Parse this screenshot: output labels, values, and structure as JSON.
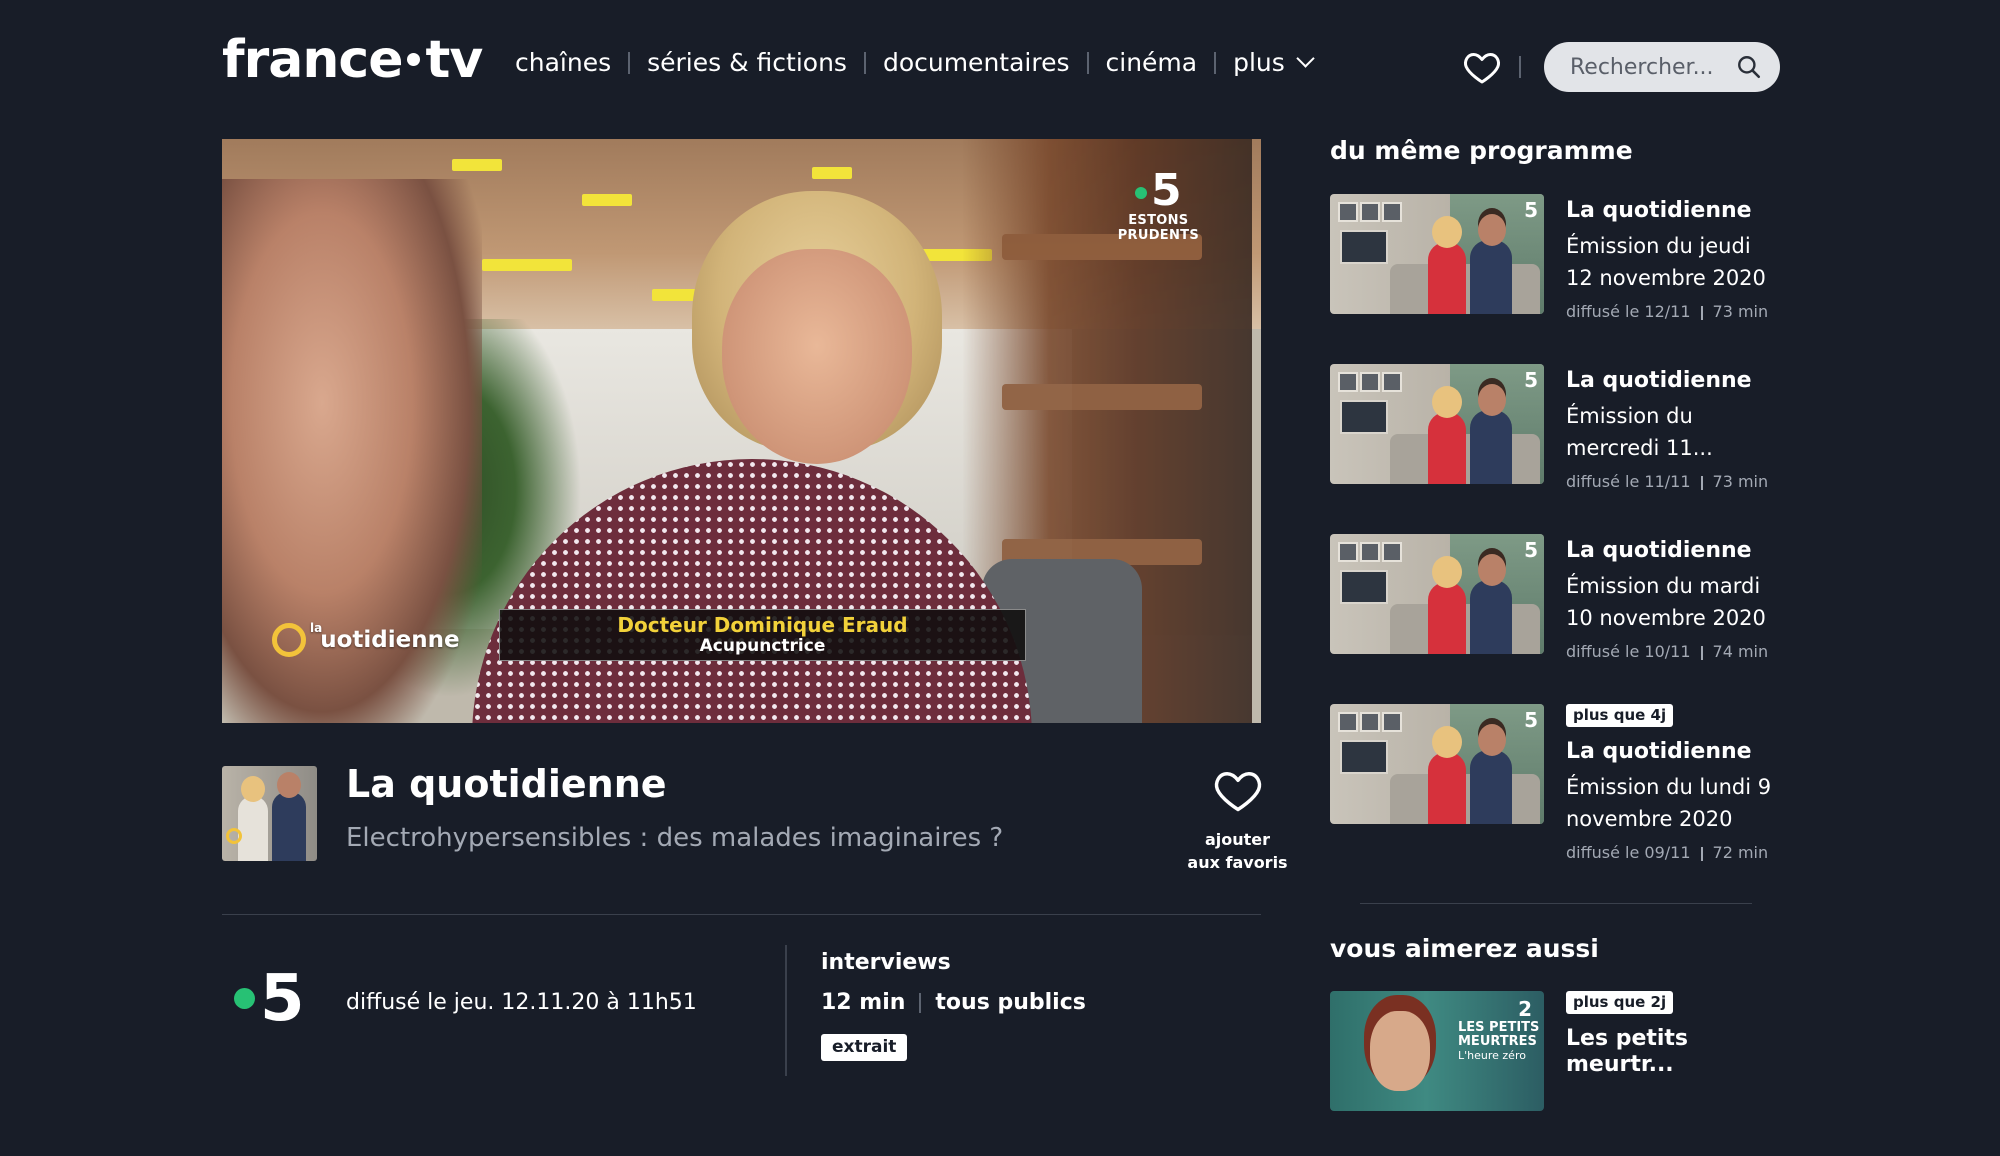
{
  "header": {
    "logo_left": "france",
    "logo_right": "tv",
    "nav": [
      "chaînes",
      "séries & fictions",
      "documentaires",
      "cinéma",
      "plus"
    ],
    "search_placeholder": "Rechercher..."
  },
  "player": {
    "channel_number": "5",
    "channel_tagline_1": "ESTONS",
    "channel_tagline_2": "PRUDENTS",
    "show_logo_small": "la",
    "show_logo_text": "uotidienne",
    "guest_name": "Docteur Dominique Eraud",
    "guest_role": "Acupunctrice"
  },
  "program": {
    "title": "La quotidienne",
    "subtitle": "Electrohypersensibles : des malades imaginaires ?",
    "favorite_line1": "ajouter",
    "favorite_line2": "aux favoris",
    "channel": "5",
    "aired": "diffusé le jeu. 12.11.20 à 11h51",
    "genre": "interviews",
    "duration": "12 min",
    "audience": "tous publics",
    "badge": "extrait"
  },
  "sidebar": {
    "same_program_title": "du même programme",
    "episodes": [
      {
        "title": "La quotidienne",
        "subtitle": "Émission du jeudi 12 novembre 2020",
        "aired": "diffusé le 12/11",
        "duration": "73 min"
      },
      {
        "title": "La quotidienne",
        "subtitle": "Émission du mercredi 11...",
        "aired": "diffusé le 11/11",
        "duration": "73 min"
      },
      {
        "title": "La quotidienne",
        "subtitle": "Émission du mardi 10 novembre 2020",
        "aired": "diffusé le 10/11",
        "duration": "74 min"
      },
      {
        "badge": "plus que 4j",
        "title": "La quotidienne",
        "subtitle": "Émission du lundi 9 novembre 2020",
        "aired": "diffusé le 09/11",
        "duration": "72 min"
      }
    ],
    "recommend_title": "vous aimerez aussi",
    "recommendations": [
      {
        "badge": "plus que 2j",
        "title": "Les petits meurtr...",
        "thumb_text_1": "LES PETITS",
        "thumb_text_2": "MEURTRES",
        "thumb_text_3": "L'heure zéro",
        "thumb_channel": "2"
      }
    ]
  },
  "colors": {
    "background": "#181d28",
    "accent_green": "#27c174",
    "muted_text": "#a3a9b4",
    "lower_third_name": "#f2d13a"
  }
}
